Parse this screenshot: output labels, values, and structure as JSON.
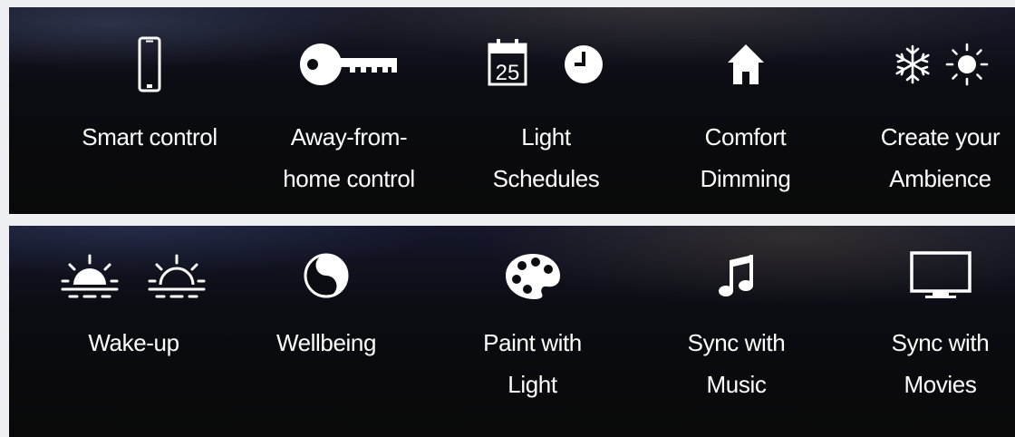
{
  "features_top": [
    {
      "icon": "smartphone-icon",
      "lines": [
        "Smart control"
      ]
    },
    {
      "icon": "key-icon",
      "lines": [
        "Away-from-",
        "home control"
      ]
    },
    {
      "icon": "calendar-clock-icon",
      "calendar_day": "25",
      "lines": [
        "Light",
        "Schedules"
      ]
    },
    {
      "icon": "house-icon",
      "lines": [
        "Comfort",
        "Dimming"
      ]
    },
    {
      "icon": "snowflake-sun-icon",
      "lines": [
        "Create your",
        "Ambience"
      ]
    }
  ],
  "features_bottom": [
    {
      "icon": "sunrise-sunset-icon",
      "lines": [
        "Wake-up"
      ]
    },
    {
      "icon": "yin-yang-icon",
      "lines": [
        "Wellbeing"
      ]
    },
    {
      "icon": "palette-icon",
      "lines": [
        "Paint with",
        "Light"
      ]
    },
    {
      "icon": "music-note-icon",
      "lines": [
        "Sync with",
        "Music"
      ]
    },
    {
      "icon": "tv-icon",
      "lines": [
        "Sync with",
        "Movies"
      ]
    }
  ],
  "colors": {
    "panel": "#0b0c12",
    "text": "#ffffff",
    "page": "#eef0f4"
  }
}
